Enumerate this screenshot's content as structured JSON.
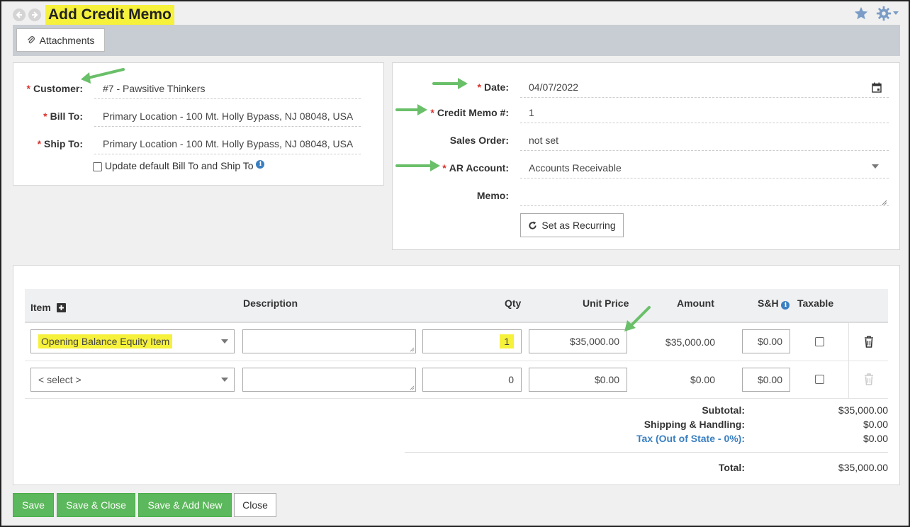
{
  "page": {
    "title": "Add Credit Memo"
  },
  "toolbar": {
    "attachments_label": "Attachments"
  },
  "customer_panel": {
    "customer": {
      "label": "Customer:",
      "value": "#7 - Pawsitive Thinkers"
    },
    "bill_to": {
      "label": "Bill To:",
      "value": "Primary Location - 100 Mt. Holly Bypass, NJ 08048, USA"
    },
    "ship_to": {
      "label": "Ship To:",
      "value": "Primary Location - 100 Mt. Holly Bypass, NJ 08048, USA"
    },
    "update_default_label": "Update default Bill To and Ship To"
  },
  "memo_panel": {
    "date": {
      "label": "Date:",
      "value": "04/07/2022"
    },
    "credit_memo_no": {
      "label": "Credit Memo #:",
      "value": "1"
    },
    "sales_order": {
      "label": "Sales Order:",
      "value": "not set"
    },
    "ar_account": {
      "label": "AR Account:",
      "value": "Accounts Receivable"
    },
    "memo": {
      "label": "Memo:",
      "value": ""
    },
    "recurring_label": "Set as Recurring"
  },
  "table": {
    "headers": {
      "item": "Item",
      "description": "Description",
      "qty": "Qty",
      "unit_price": "Unit Price",
      "amount": "Amount",
      "sh": "S&H",
      "taxable": "Taxable"
    },
    "rows": [
      {
        "item": "Opening Balance Equity Item",
        "description": "",
        "qty": "1",
        "unit_price": "$35,000.00",
        "amount": "$35,000.00",
        "sh": "$0.00"
      },
      {
        "item": "< select >",
        "description": "",
        "qty": "0",
        "unit_price": "$0.00",
        "amount": "$0.00",
        "sh": "$0.00"
      }
    ]
  },
  "totals": {
    "subtotal_label": "Subtotal:",
    "subtotal": "$35,000.00",
    "shipping_label": "Shipping & Handling:",
    "shipping": "$0.00",
    "tax_label": "Tax (Out of State - 0%):",
    "tax": "$0.00",
    "total_label": "Total:",
    "total": "$35,000.00"
  },
  "buttons": {
    "save": "Save",
    "save_close": "Save & Close",
    "save_add_new": "Save & Add New",
    "close": "Close"
  },
  "colors": {
    "accent_green": "#5cb85c",
    "highlight": "#f6f13a",
    "link_blue": "#3a7fc1",
    "required_red": "#d9332b",
    "arrow_green": "#6abf69"
  }
}
